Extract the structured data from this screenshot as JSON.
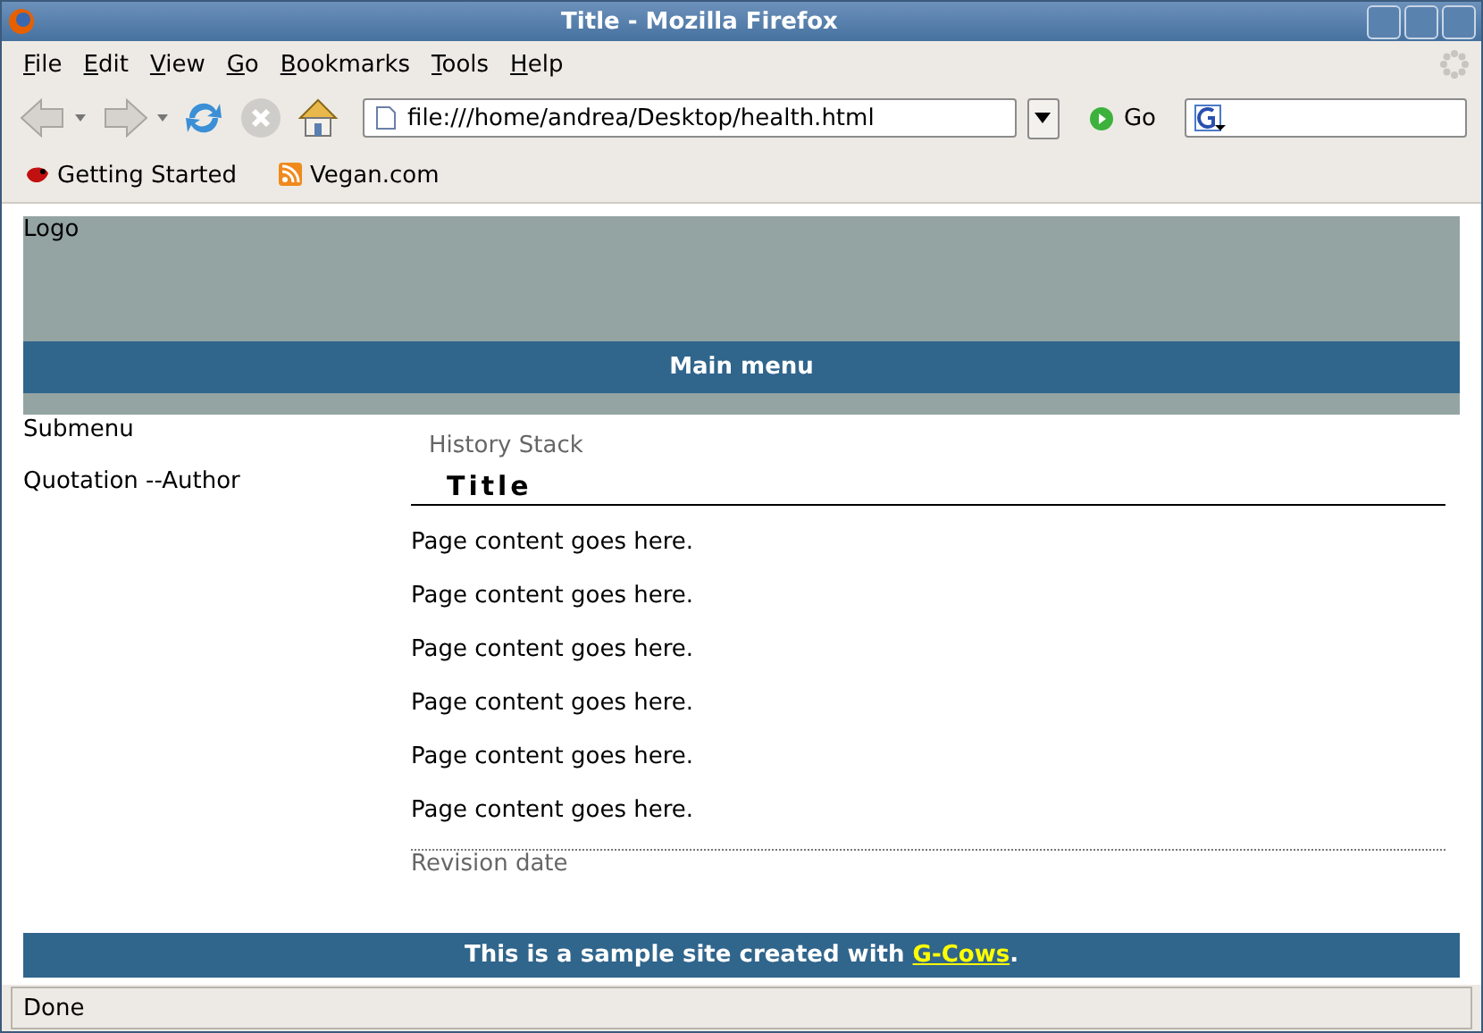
{
  "window": {
    "title": "Title - Mozilla Firefox"
  },
  "menu": [
    "File",
    "Edit",
    "View",
    "Go",
    "Bookmarks",
    "Tools",
    "Help"
  ],
  "address": {
    "value": "file:///home/andrea/Desktop/health.html"
  },
  "go_label": "Go",
  "bookmarks": [
    {
      "label": "Getting Started",
      "kind": "bug"
    },
    {
      "label": "Vegan.com",
      "kind": "feed"
    }
  ],
  "page": {
    "logo": "Logo",
    "main_menu": "Main menu",
    "submenu": "Submenu",
    "quotation": "Quotation --Author",
    "history": "History Stack",
    "heading": "Title",
    "content": [
      "Page content goes here.",
      "Page content goes here.",
      "Page content goes here.",
      "Page content goes here.",
      "Page content goes here.",
      "Page content goes here."
    ],
    "revision": "Revision date",
    "footer": {
      "before": "This is a sample site created with ",
      "link": "G-Cows",
      "after": "."
    }
  },
  "status_bar": "Done"
}
